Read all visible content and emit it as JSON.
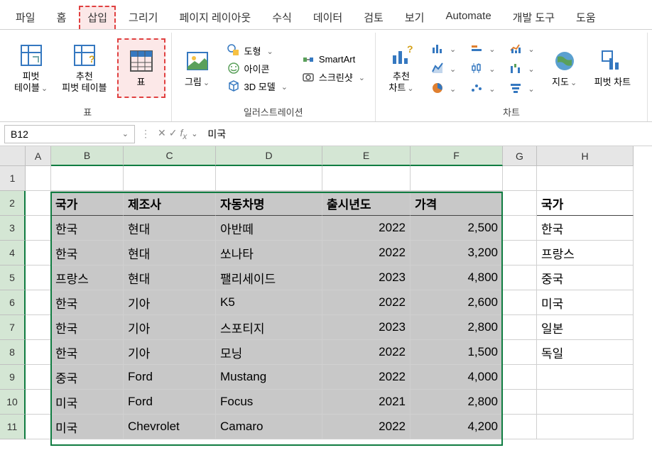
{
  "tabs": {
    "file": "파일",
    "home": "홈",
    "insert": "삽입",
    "draw": "그리기",
    "pagelayout": "페이지 레이아웃",
    "formulas": "수식",
    "data": "데이터",
    "review": "검토",
    "view": "보기",
    "automate": "Automate",
    "developer": "개발 도구",
    "help": "도움"
  },
  "ribbon": {
    "pivotTable": "피벗\n테이블",
    "recPivot": "추천\n피벗 테이블",
    "table": "표",
    "tablesGroup": "표",
    "pictures": "그림",
    "shapes": "도형",
    "icons": "아이콘",
    "model3d": "3D 모델",
    "smartart": "SmartArt",
    "screenshot": "스크린샷",
    "illustrationsGroup": "일러스트레이션",
    "recChart": "추천\n차트",
    "chartsGroup": "차트",
    "map": "지도",
    "pivotChart": "피벗 차트"
  },
  "namebox": {
    "value": "B12",
    "formula_value": "미국"
  },
  "columns": [
    "A",
    "B",
    "C",
    "D",
    "E",
    "F",
    "G",
    "H"
  ],
  "rows": [
    1,
    2,
    3,
    4,
    5,
    6,
    7,
    8,
    9,
    10,
    11
  ],
  "data_headers": {
    "country": "국가",
    "maker": "제조사",
    "carname": "자동차명",
    "year": "출시년도",
    "price": "가격"
  },
  "table_rows": [
    {
      "country": "한국",
      "maker": "현대",
      "car": "아반떼",
      "year": "2022",
      "price": "2,500"
    },
    {
      "country": "한국",
      "maker": "현대",
      "car": "쏘나타",
      "year": "2022",
      "price": "3,200"
    },
    {
      "country": "프랑스",
      "maker": "현대",
      "car": "팰리세이드",
      "year": "2023",
      "price": "4,800"
    },
    {
      "country": "한국",
      "maker": "기아",
      "car": "K5",
      "year": "2022",
      "price": "2,600"
    },
    {
      "country": "한국",
      "maker": "기아",
      "car": "스포티지",
      "year": "2023",
      "price": "2,800"
    },
    {
      "country": "한국",
      "maker": "기아",
      "car": "모닝",
      "year": "2022",
      "price": "1,500"
    },
    {
      "country": "중국",
      "maker": "Ford",
      "car": "Mustang",
      "year": "2022",
      "price": "4,000"
    },
    {
      "country": "미국",
      "maker": "Ford",
      "car": "Focus",
      "year": "2021",
      "price": "2,800"
    },
    {
      "country": "미국",
      "maker": "Chevrolet",
      "car": "Camaro",
      "year": "2022",
      "price": "4,200"
    }
  ],
  "col_h": {
    "header": "국가",
    "values": [
      "한국",
      "프랑스",
      "중국",
      "미국",
      "일본",
      "독일"
    ]
  }
}
